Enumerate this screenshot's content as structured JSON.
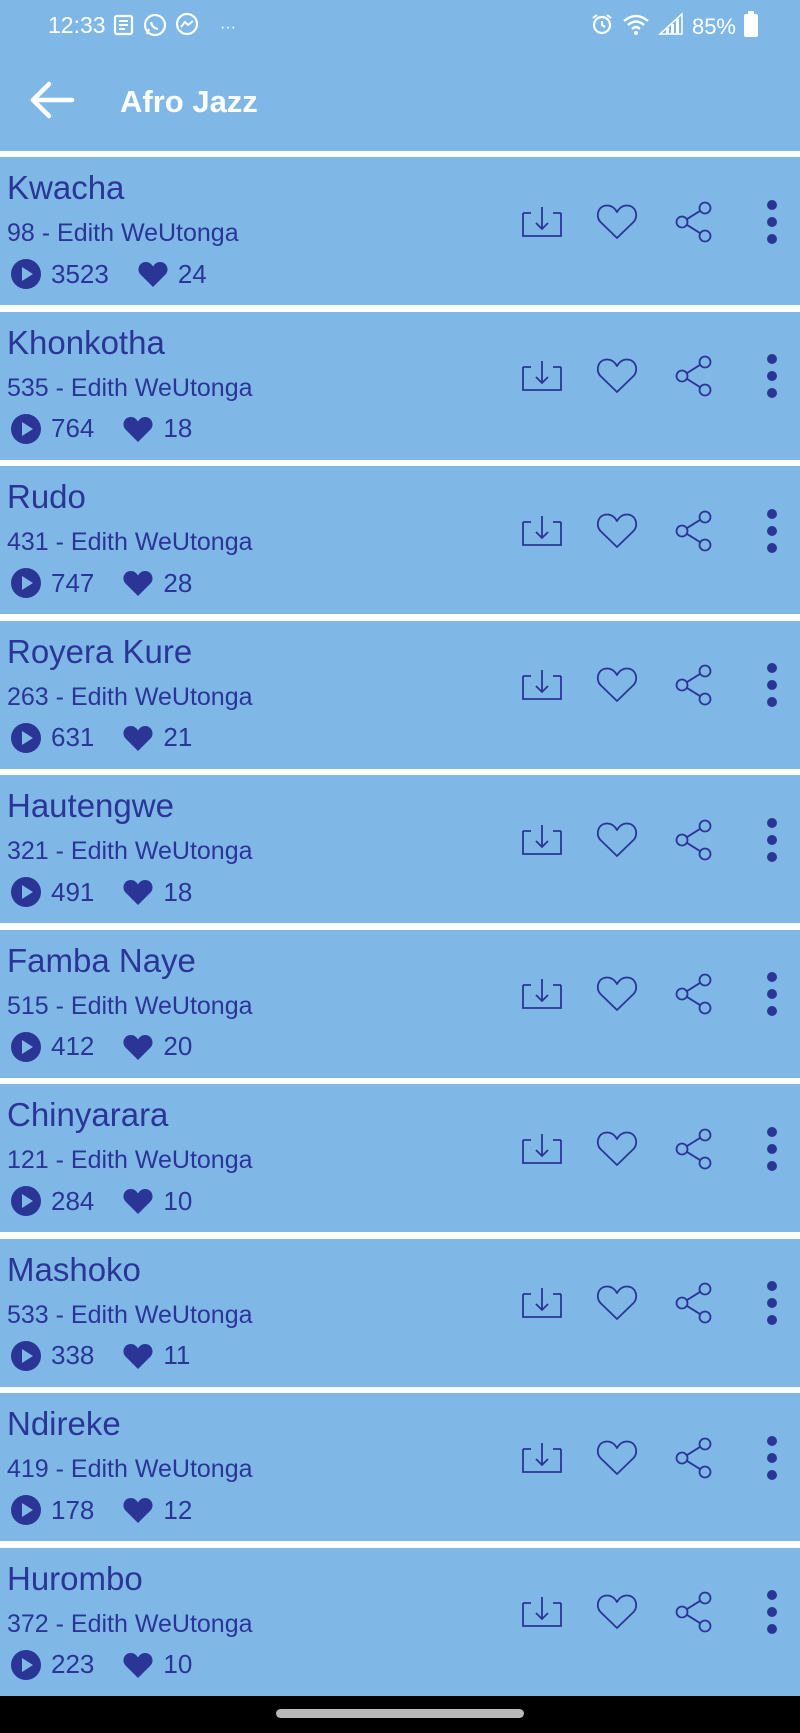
{
  "status_bar": {
    "time": "12:33",
    "battery": "85%",
    "icons": [
      "news-icon",
      "whatsapp-icon",
      "messenger-icon",
      "more-notifications-icon",
      "alarm-icon",
      "wifi-icon",
      "signal-icon",
      "battery-icon"
    ]
  },
  "appbar": {
    "title": "Afro Jazz",
    "back_icon": "arrow-left-icon"
  },
  "colors": {
    "background": "#7fb8e6",
    "text": "#2b3596",
    "header_text": "#ffffff"
  },
  "songs": [
    {
      "title": "Kwacha",
      "subtitle": "98 - Edith WeUtonga",
      "plays": "3523",
      "likes": "24"
    },
    {
      "title": "Khonkotha",
      "subtitle": "535 - Edith WeUtonga",
      "plays": "764",
      "likes": "18"
    },
    {
      "title": "Rudo",
      "subtitle": "431 - Edith WeUtonga",
      "plays": "747",
      "likes": "28"
    },
    {
      "title": "Royera Kure",
      "subtitle": "263 - Edith WeUtonga",
      "plays": "631",
      "likes": "21"
    },
    {
      "title": "Hautengwe",
      "subtitle": "321 - Edith WeUtonga",
      "plays": "491",
      "likes": "18"
    },
    {
      "title": "Famba Naye",
      "subtitle": "515 - Edith WeUtonga",
      "plays": "412",
      "likes": "20"
    },
    {
      "title": "Chinyarara",
      "subtitle": "121 - Edith WeUtonga",
      "plays": "284",
      "likes": "10"
    },
    {
      "title": "Mashoko",
      "subtitle": "533 - Edith WeUtonga",
      "plays": "338",
      "likes": "11"
    },
    {
      "title": "Ndireke",
      "subtitle": "419 - Edith WeUtonga",
      "plays": "178",
      "likes": "12"
    },
    {
      "title": "Hurombo",
      "subtitle": "372 - Edith WeUtonga",
      "plays": "223",
      "likes": "10"
    }
  ]
}
